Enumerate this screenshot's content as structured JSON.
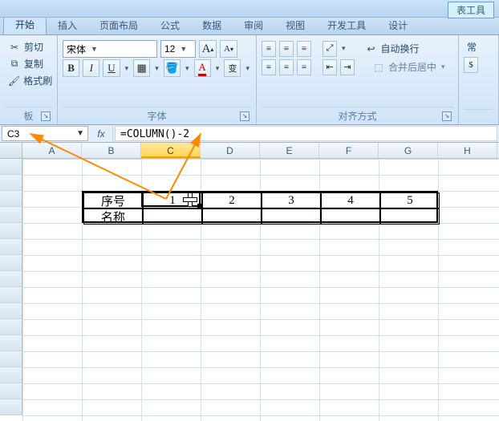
{
  "window": {
    "context_tab": "表工具"
  },
  "tabs": {
    "items": [
      "开始",
      "插入",
      "页面布局",
      "公式",
      "数据",
      "审阅",
      "视图",
      "开发工具",
      "设计"
    ],
    "active_index": 0
  },
  "clipboard": {
    "cut": "剪切",
    "copy": "复制",
    "paint": "格式刷",
    "group_label": "板"
  },
  "font": {
    "name": "宋体",
    "size": "12",
    "grow": "A",
    "shrink": "A",
    "bold": "B",
    "italic": "I",
    "underline": "U",
    "border_dd": "▾",
    "fill_dd": "▾",
    "color_dd": "▾",
    "phonetic": "变",
    "group_label": "字体"
  },
  "align": {
    "wrap": "自动换行",
    "merge": "合并后居中",
    "group_label": "对齐方式",
    "extra_label": "常"
  },
  "formula_bar": {
    "name_box": "C3",
    "fx_label": "fx",
    "formula": "=COLUMN()-2"
  },
  "columns": {
    "widths": [
      28,
      74,
      74,
      74,
      74,
      74,
      74,
      74,
      74
    ],
    "labels": [
      "A",
      "B",
      "C",
      "D",
      "E",
      "F",
      "G",
      "H"
    ],
    "selected_index": 2
  },
  "rows": {
    "height": 20,
    "count": 16
  },
  "table": {
    "r1_label": "序号",
    "r2_label": "名称",
    "values": [
      "1",
      "2",
      "3",
      "4",
      "5"
    ]
  },
  "chart_data": null
}
